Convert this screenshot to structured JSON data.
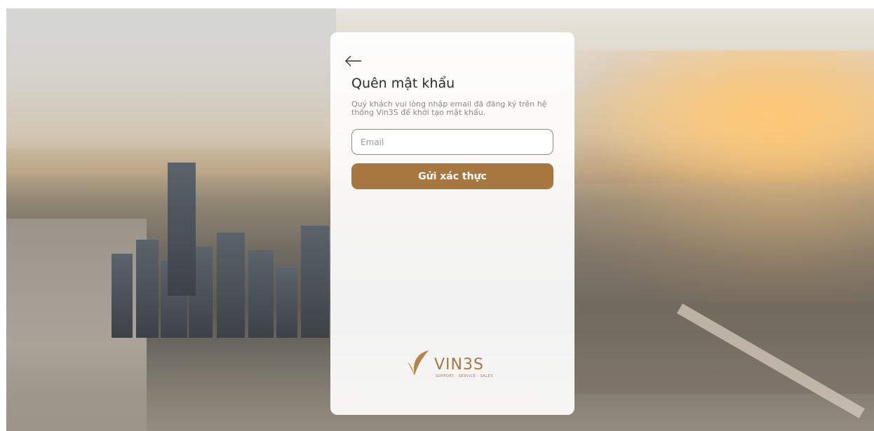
{
  "page": {
    "title": "Quên mật khẩu",
    "subtitle": "Quý khách vui lòng nhập email đã đăng ký trên hệ thống Vin3S để khởi tạo mật khẩu."
  },
  "form": {
    "email_placeholder": "Email",
    "email_value": "",
    "submit_label": "Gửi xác thực"
  },
  "brand": {
    "logo_text": "VIN3S",
    "tagline": "SUPPORT · SERVICE · SALES",
    "accent_color": "#a8773f"
  },
  "icons": {
    "back": "back-arrow-icon"
  }
}
